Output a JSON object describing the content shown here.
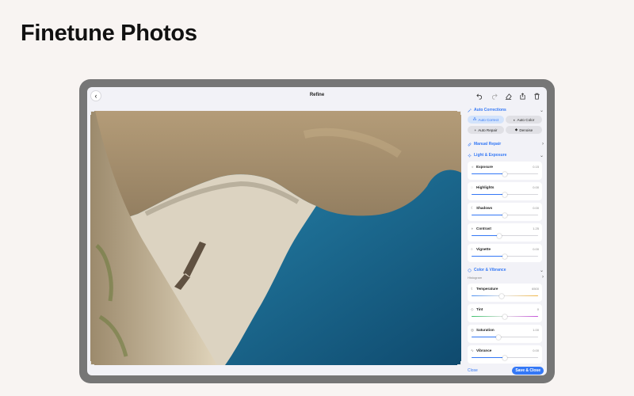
{
  "page": {
    "headline": "Finetune Photos"
  },
  "editor": {
    "title": "Refine",
    "toolbar": [
      "undo-icon",
      "redo-icon",
      "eraser-icon",
      "share-icon",
      "trash-icon"
    ]
  },
  "panel": {
    "auto_corrections": {
      "title": "Auto Corrections",
      "buttons": [
        {
          "label": "Auto Correct",
          "icon": "magic-wand-icon",
          "active": true
        },
        {
          "label": "Auto Color",
          "icon": "palette-icon",
          "active": false
        },
        {
          "label": "Auto Repair",
          "icon": "plus-icon",
          "active": false
        },
        {
          "label": "Denoise",
          "icon": "denoise-icon",
          "active": false
        }
      ]
    },
    "manual_repair": {
      "title": "Manual Repair"
    },
    "light_exposure": {
      "title": "Light & Exposure",
      "sliders": [
        {
          "label": "Exposure",
          "value": "0.15",
          "level": 0.5
        },
        {
          "label": "Highlights",
          "value": "0.00",
          "level": 0.5
        },
        {
          "label": "Shadows",
          "value": "0.00",
          "level": 0.5
        },
        {
          "label": "Contrast",
          "value": "1.25",
          "level": 0.42
        },
        {
          "label": "Vignette",
          "value": "0.00",
          "level": 0.5
        }
      ]
    },
    "color_vibrance": {
      "title": "Color & Vibrance",
      "sub_label": "Histogram",
      "sliders": [
        {
          "label": "Temperature",
          "value": "6500",
          "level": 0.45
        },
        {
          "label": "Tint",
          "value": "0",
          "level": 0.5
        },
        {
          "label": "Saturation",
          "value": "1.00",
          "level": 0.4
        },
        {
          "label": "Vibrance",
          "value": "0.00",
          "level": 0.5
        }
      ]
    }
  },
  "footer": {
    "close_label": "Close",
    "save_label": "Save & Close"
  },
  "colors": {
    "accent": "#3478f6",
    "device_frame": "#767676",
    "page_bg": "#f8f4f2"
  }
}
